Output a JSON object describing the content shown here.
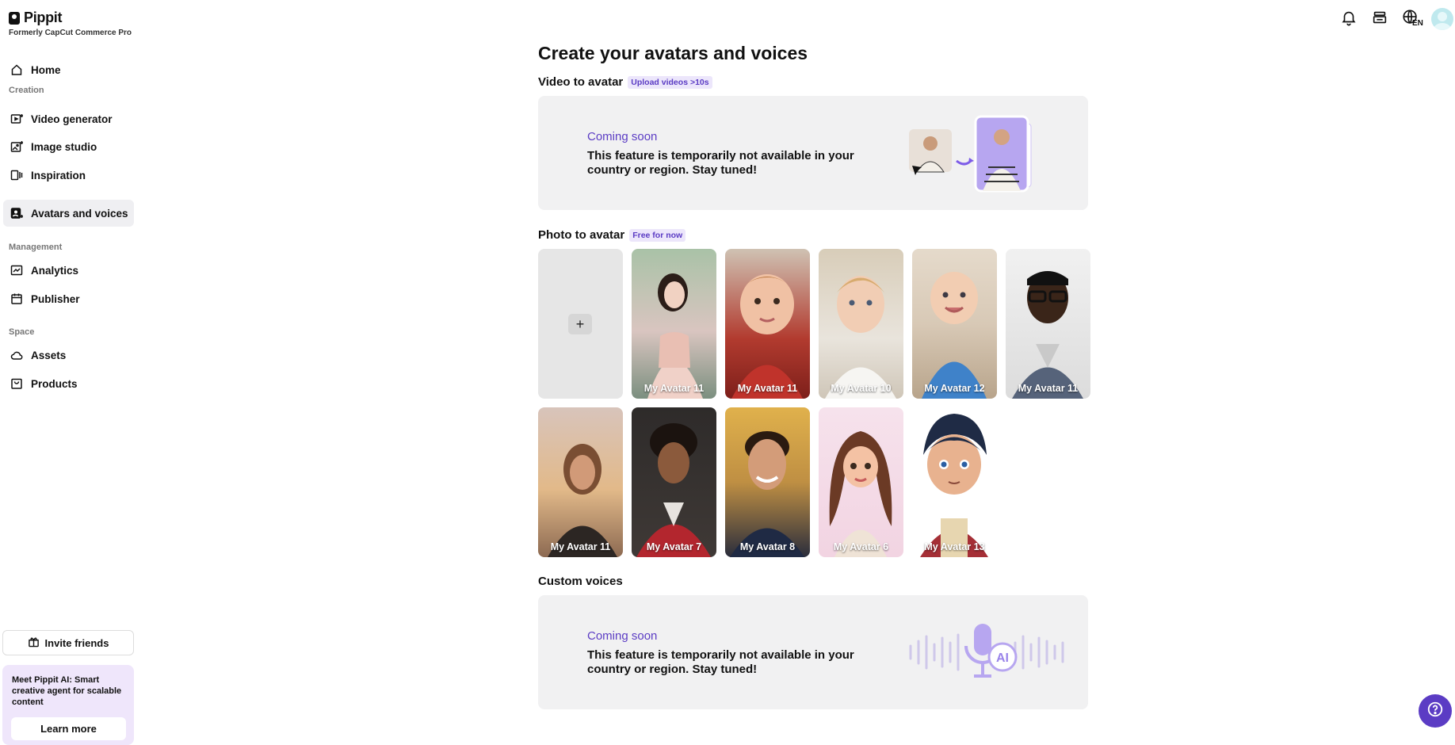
{
  "brand": {
    "name": "Pippit",
    "subtitle": "Formerly CapCut Commerce Pro"
  },
  "sidebar": {
    "home": "Home",
    "sections": {
      "creation": "Creation",
      "management": "Management",
      "space": "Space"
    },
    "items": [
      {
        "label": "Video generator",
        "icon": "video-plus-icon"
      },
      {
        "label": "Image studio",
        "icon": "image-plus-icon"
      },
      {
        "label": "Inspiration",
        "icon": "inspiration-icon"
      },
      {
        "label": "Avatars and voices",
        "icon": "avatar-icon",
        "active": true
      },
      {
        "label": "Analytics",
        "icon": "analytics-icon"
      },
      {
        "label": "Publisher",
        "icon": "calendar-icon"
      },
      {
        "label": "Assets",
        "icon": "cloud-icon"
      },
      {
        "label": "Products",
        "icon": "product-box-icon"
      }
    ],
    "invite_label": "Invite friends",
    "promo": {
      "text": "Meet Pippit AI: Smart creative agent for scalable content",
      "button": "Learn more"
    }
  },
  "header": {
    "language": "EN"
  },
  "main": {
    "title": "Create your avatars and voices",
    "video_to_avatar": {
      "heading": "Video to avatar",
      "badge": "Upload videos >10s",
      "coming_soon": "Coming soon",
      "message": "This feature is temporarily not available in your country or region. Stay tuned!"
    },
    "photo_to_avatar": {
      "heading": "Photo to avatar",
      "badge": "Free for now",
      "add_symbol": "+",
      "avatars": [
        {
          "label": "My Avatar 11",
          "style": "woman-pink"
        },
        {
          "label": "My Avatar 11",
          "style": "baby-red"
        },
        {
          "label": "My Avatar 10",
          "style": "toddler-white"
        },
        {
          "label": "My Avatar 12",
          "style": "baby-blue"
        },
        {
          "label": "My Avatar 11",
          "style": "man-glasses"
        },
        {
          "label": "My Avatar 11",
          "style": "woman-sunset"
        },
        {
          "label": "My Avatar 7",
          "style": "man-curly"
        },
        {
          "label": "My Avatar 8",
          "style": "man-smile"
        },
        {
          "label": "My Avatar 6",
          "style": "cartoon-woman"
        },
        {
          "label": "My Avatar 13",
          "style": "cartoon-boy"
        }
      ]
    },
    "custom_voices": {
      "heading": "Custom voices",
      "coming_soon": "Coming soon",
      "message": "This feature is temporarily not available in your country or region. Stay tuned!",
      "ai_badge": "AI"
    }
  },
  "colors": {
    "accent": "#5b3cc4",
    "card_bg": "#f1f1f2",
    "active_nav": "#efeff2"
  }
}
